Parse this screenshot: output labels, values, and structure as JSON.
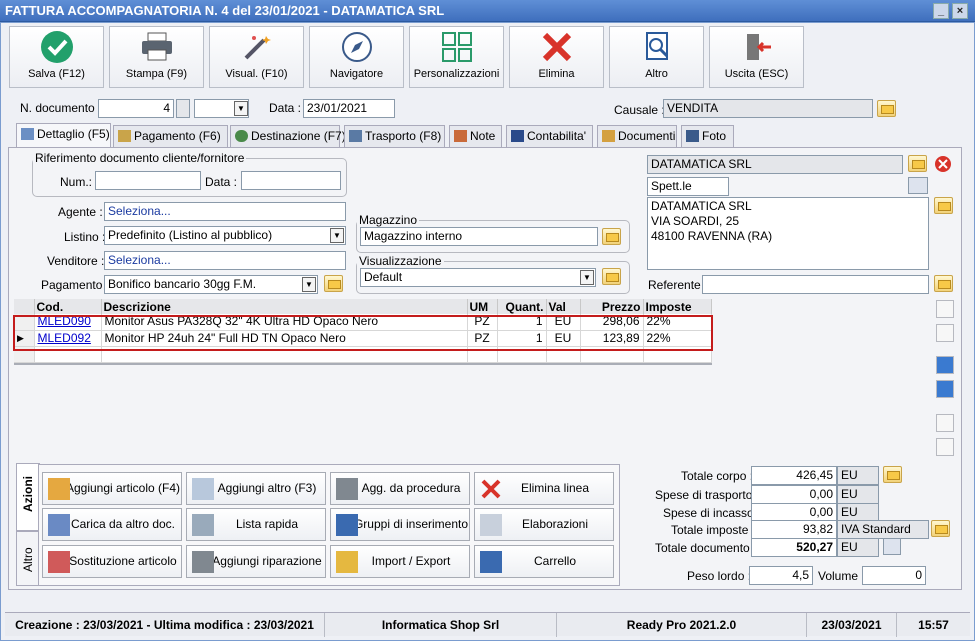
{
  "window": {
    "title": "FATTURA ACCOMPAGNATORIA N. 4 del 23/01/2021 - DATAMATICA SRL"
  },
  "toolbar": [
    {
      "label": "Salva (F12)",
      "icon": "check-icon"
    },
    {
      "label": "Stampa (F9)",
      "icon": "printer-icon"
    },
    {
      "label": "Visual. (F10)",
      "icon": "magic-wand-icon"
    },
    {
      "label": "Navigatore",
      "icon": "compass-icon"
    },
    {
      "label": "Personalizzazioni",
      "icon": "grid-icon"
    },
    {
      "label": "Elimina",
      "icon": "delete-x-icon"
    },
    {
      "label": "Altro",
      "icon": "search-doc-icon"
    },
    {
      "label": "Uscita (ESC)",
      "icon": "exit-door-icon"
    }
  ],
  "header": {
    "doc_label": "N. documento :",
    "doc_number": "4",
    "data_label": "Data :",
    "data_value": "23/01/2021",
    "causale_label": "Causale :",
    "causale_value": "VENDITA"
  },
  "tabs": [
    "Dettaglio (F5)",
    "Pagamento (F6)",
    "Destinazione (F7)",
    "Trasporto (F8)",
    "Note",
    "Contabilita'",
    "Documenti",
    "Foto"
  ],
  "rif": {
    "legend": "Riferimento documento cliente/fornitore",
    "num_label": "Num.:",
    "data_label": "Data :"
  },
  "fields": {
    "agente_label": "Agente :",
    "agente_value": "Seleziona...",
    "listino_label": "Listino :",
    "listino_value": "Predefinito (Listino al pubblico)",
    "venditore_label": "Venditore :",
    "venditore_value": "Seleziona...",
    "pagamento_label": "Pagamento :",
    "pagamento_value": "Bonifico bancario 30gg F.M.",
    "magazzino_legend": "Magazzino",
    "magazzino_value": "Magazzino interno",
    "visual_legend": "Visualizzazione",
    "visual_value": "Default"
  },
  "cliente": {
    "name": "DATAMATICA SRL",
    "spett": "Spett.le",
    "addr1": "DATAMATICA SRL",
    "addr2": "VIA SOARDI, 25",
    "addr3": "48100 RAVENNA (RA)",
    "referente_label": "Referente"
  },
  "grid": {
    "headers": [
      "Cod.",
      "Descrizione",
      "UM",
      "Quant.",
      "Val",
      "Prezzo",
      "Imposte"
    ],
    "rows": [
      [
        "MLED090",
        "Monitor Asus PA328Q 32\" 4K Ultra HD Opaco Nero",
        "PZ",
        "1",
        "EU",
        "298,06",
        "22%"
      ],
      [
        "MLED092",
        "Monitor HP 24uh 24\" Full HD TN Opaco Nero",
        "PZ",
        "1",
        "EU",
        "123,89",
        "22%"
      ]
    ]
  },
  "vtabs": [
    "Azioni",
    "Altro"
  ],
  "actions": [
    [
      "Aggiungi articolo (F4)",
      "Aggiungi altro (F3)",
      "Agg. da procedura",
      "Elimina linea"
    ],
    [
      "Carica da altro doc.",
      "Lista rapida",
      "Gruppi di inserimento",
      "Elaborazioni"
    ],
    [
      "Sostituzione articolo",
      "Aggiungi riparazione",
      "Import / Export",
      "Carrello"
    ]
  ],
  "totals": {
    "corpo_label": "Totale corpo :",
    "corpo": "426,45",
    "trasp_label": "Spese di trasporto :",
    "trasp": "0,00",
    "incasso_label": "Spese di incasso :",
    "incasso": "0,00",
    "imposte_label": "Totale imposte :",
    "imposte": "93,82",
    "iva": "IVA Standard",
    "doc_label": "Totale documento :",
    "doc": "520,27",
    "cur": "EU",
    "peso_label": "Peso lordo :",
    "peso": "4,5",
    "volume_label": "Volume :",
    "volume": "0"
  },
  "status": {
    "dates": "Creazione : 23/03/2021 - Ultima modifica : 23/03/2021",
    "company": "Informatica Shop Srl",
    "version": "Ready Pro 2021.2.0",
    "date": "23/03/2021",
    "time": "15:57"
  }
}
